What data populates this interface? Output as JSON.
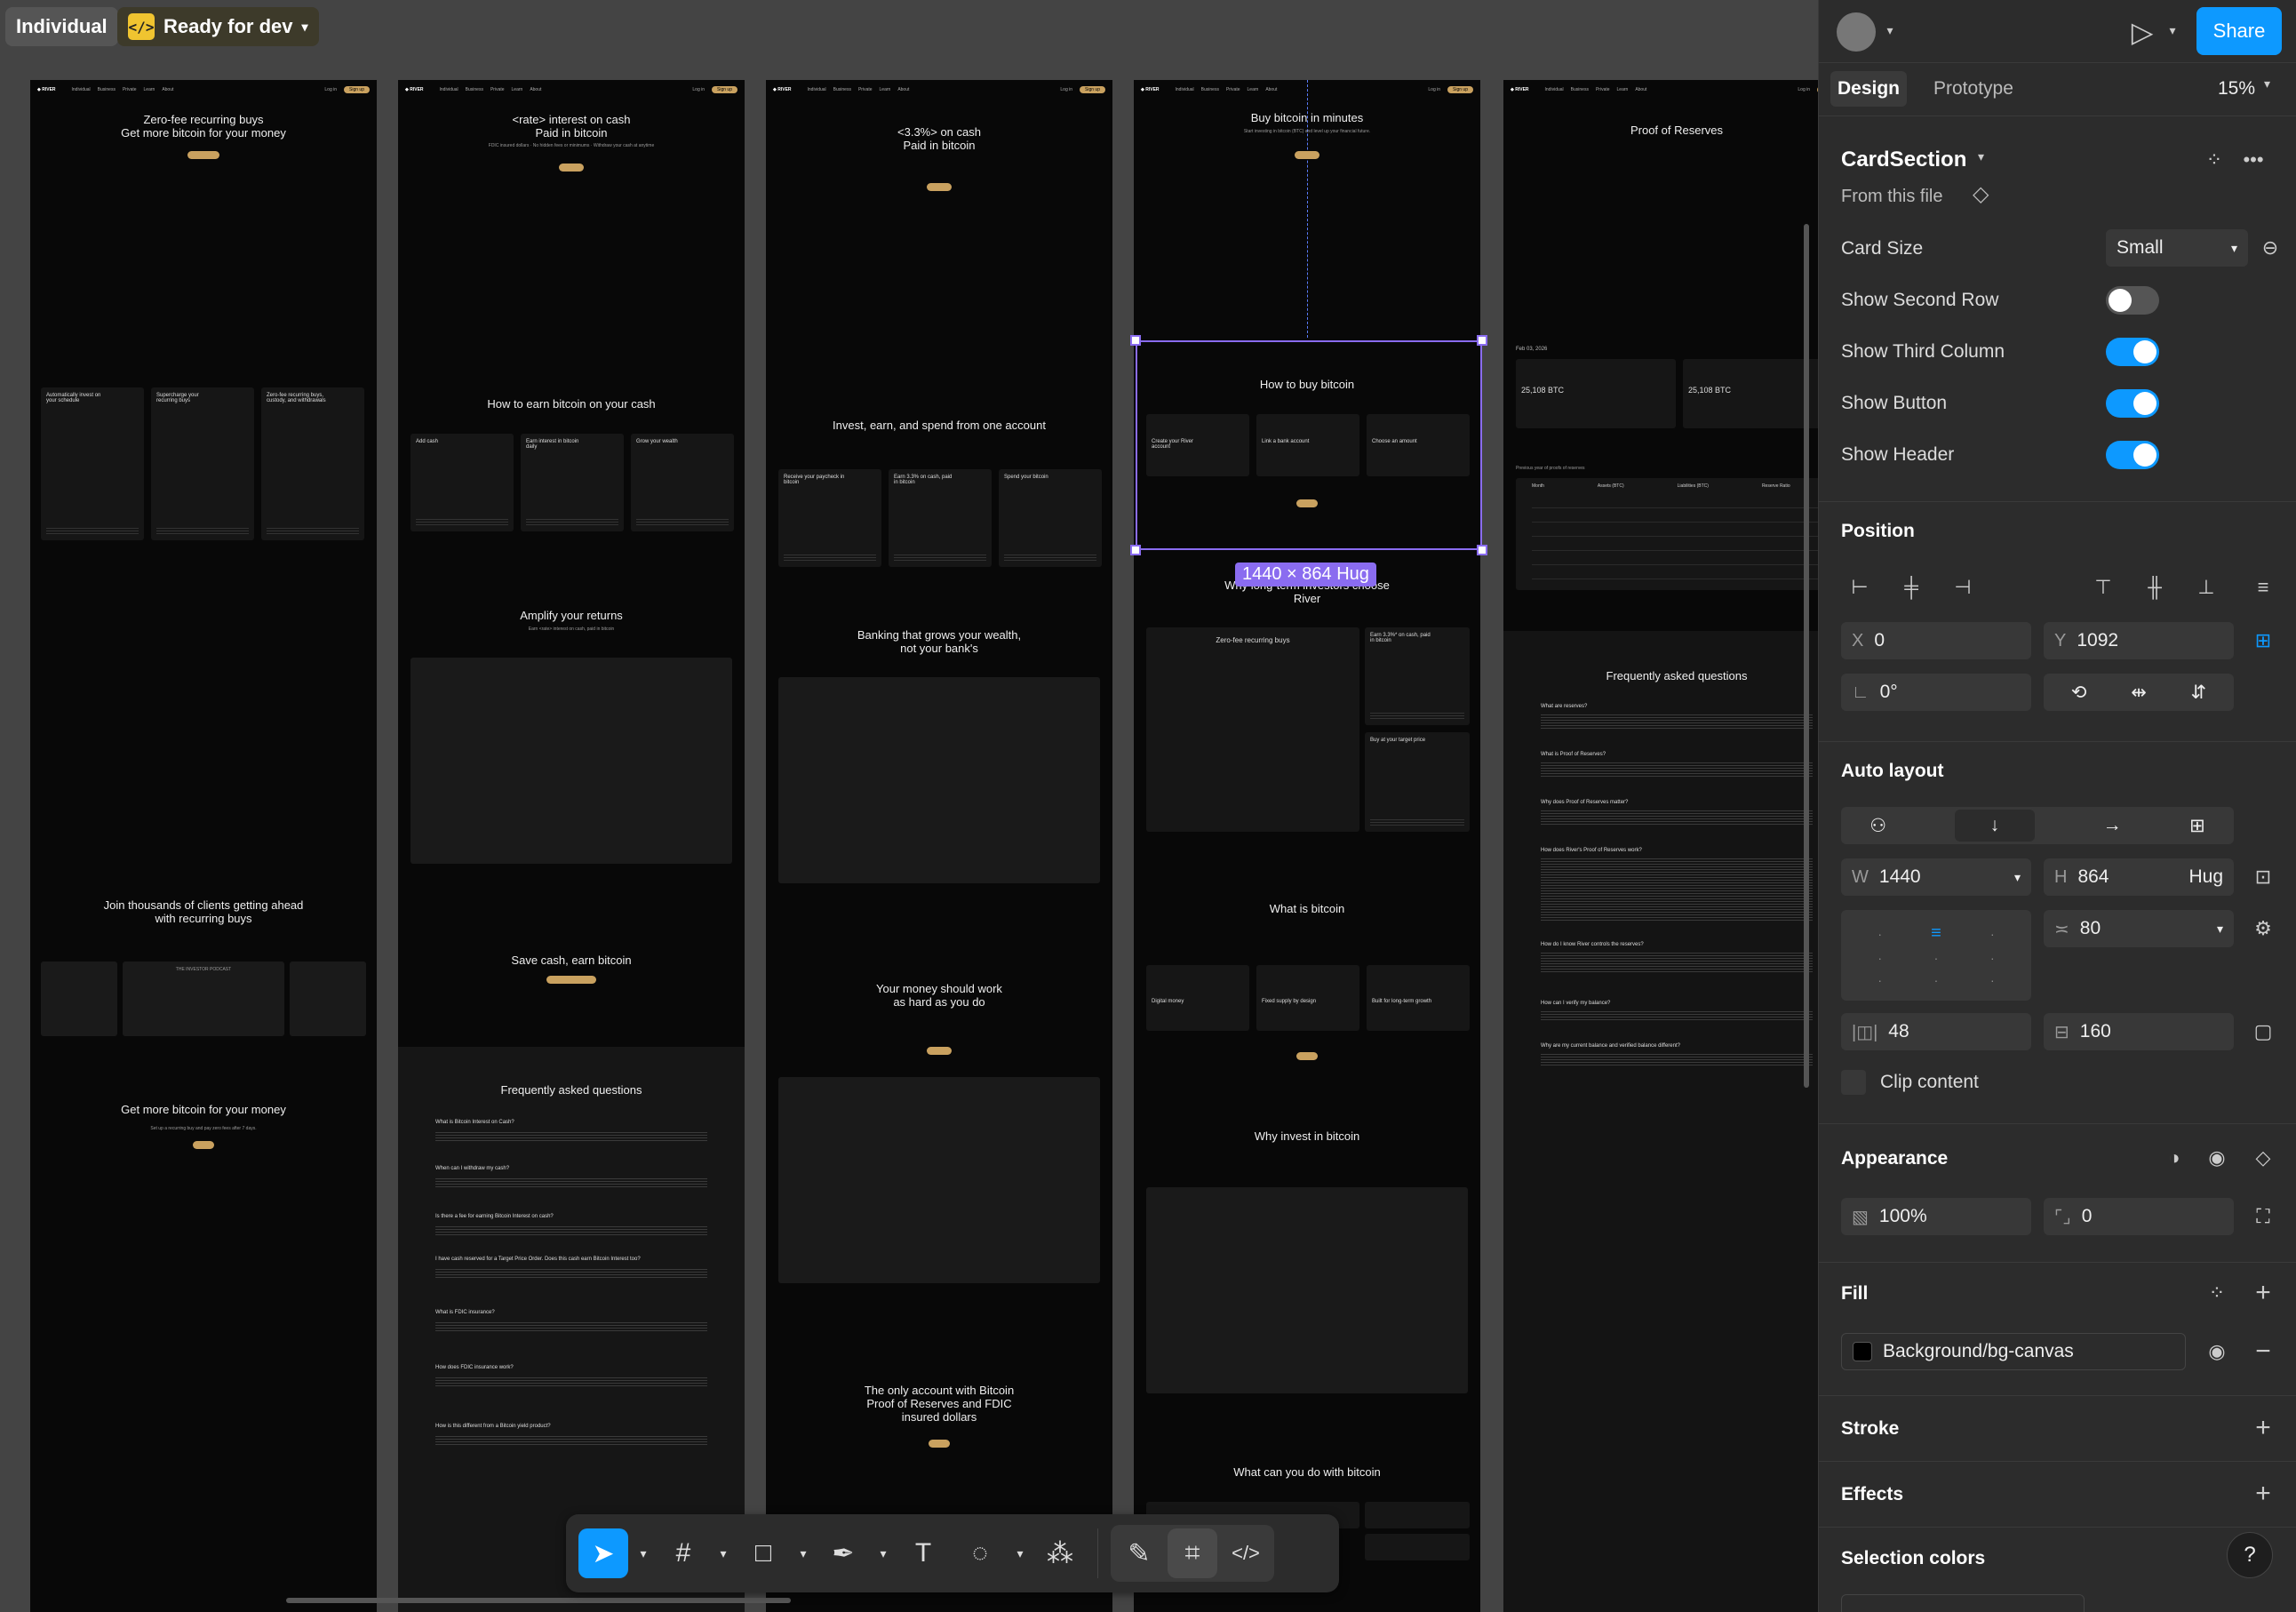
{
  "topbar": {
    "individual": "Individual",
    "ready_for_dev": "Ready for dev",
    "dev_icon": "</>"
  },
  "selection_badge": "1440 × 864 Hug",
  "frames": [
    {
      "hero_title": "Zero-fee recurring buys\nGet more bitcoin for your money",
      "card_titles": [
        "Automatically invest on your schedule",
        "Supercharge your recurring buys",
        "Zero-fee recurring buys, custody, and withdrawals"
      ],
      "section1": "Join thousands of clients getting ahead\nwith recurring buys",
      "podcast": "THE INVESTOR PODCAST",
      "section2": "Get more bitcoin for your money",
      "section2_sub": "Set up a recurring buy and pay zero fees after 7 days."
    },
    {
      "hero_title": "<rate> interest on cash\nPaid in bitcoin",
      "hero_sub": "FDIC insured dollars · No hidden fees or minimums · Withdraw your cash at anytime",
      "section1": "How to earn bitcoin on your cash",
      "card_titles": [
        "Add cash",
        "Earn interest in bitcoin daily",
        "Grow your wealth"
      ],
      "section2": "Amplify your returns",
      "section2_sub": "Earn <rate> interest on cash, paid in bitcoin",
      "section3": "Save cash, earn bitcoin",
      "faq_title": "Frequently asked questions",
      "faq_items": [
        "What is Bitcoin Interest on Cash?",
        "When can I withdraw my cash?",
        "Is there a fee for earning Bitcoin Interest on cash?",
        "I have cash reserved for a Target Price Order. Does this cash earn Bitcoin Interest too?",
        "What is FDIC insurance?",
        "How does FDIC insurance work?",
        "How is this different from a Bitcoin yield product?"
      ]
    },
    {
      "hero_title": "<3.3%> on cash\nPaid in bitcoin",
      "section1": "Invest, earn, and spend from one account",
      "card_titles": [
        "Receive your paycheck in bitcoin",
        "Earn 3.3% on cash, paid in bitcoin",
        "Spend your bitcoin"
      ],
      "section2": "Banking that grows your wealth,\nnot your bank's",
      "section3": "Your money should work\nas hard as you do",
      "section4": "The only account with Bitcoin\nProof of Reserves and FDIC\ninsured dollars"
    },
    {
      "hero_title": "Buy bitcoin in minutes",
      "hero_sub": "Start investing in bitcoin (BTC) and level up your financial future.",
      "selected_title": "How to buy bitcoin",
      "card_titles": [
        "Create your River account",
        "Link a bank account",
        "Choose an amount"
      ],
      "section1": "Why long-term investors choose\nRiver",
      "feature_cards": [
        "Zero-fee recurring buys",
        "Earn 3.3%* on cash, paid in bitcoin",
        "Buy at your target price"
      ],
      "section2": "What is bitcoin",
      "section2_cards": [
        "Digital money",
        "Fixed supply by design",
        "Built for long-term growth"
      ],
      "section3": "Why invest in bitcoin",
      "section4": "What can you do with bitcoin"
    },
    {
      "hero_title": "Proof of Reserves",
      "date": "Feb 03, 2026",
      "stats": [
        "25,108 BTC",
        "25,108 BTC"
      ],
      "table_label": "Previous year of proofs of reserves",
      "table_headers": [
        "Month",
        "Assets (BTC)",
        "Liabilities (BTC)",
        "Reserve Ratio"
      ],
      "faq_title": "Frequently asked questions",
      "faq_items": [
        "What are reserves?",
        "What is Proof of Reserves?",
        "Why does Proof of Reserves matter?",
        "How does River's Proof of Reserves work?",
        "How do I know River controls the reserves?",
        "How can I verify my balance?",
        "Why are my current balance and verified balance different?"
      ]
    }
  ],
  "toolbar": {
    "items": [
      "move-tool",
      "frame-tool",
      "shape-tool",
      "pen-tool",
      "text-tool",
      "comment-tool",
      "actions-tool",
      "draw-mode",
      "design-mode",
      "dev-mode"
    ]
  },
  "panel": {
    "tabs": {
      "design": "Design",
      "prototype": "Prototype",
      "zoom": "15%"
    },
    "share": "Share",
    "component": {
      "name": "CardSection",
      "source": "From this file"
    },
    "props": [
      {
        "label": "Card Size",
        "value": "Small"
      },
      {
        "label": "Show Second Row",
        "on": false
      },
      {
        "label": "Show Third Column",
        "on": true
      },
      {
        "label": "Show Button",
        "on": true
      },
      {
        "label": "Show Header",
        "on": true
      }
    ],
    "position": {
      "title": "Position",
      "x_label": "X",
      "x": "0",
      "y_label": "Y",
      "y": "1092",
      "rotation": "0°"
    },
    "autolayout": {
      "title": "Auto layout",
      "w_label": "W",
      "w": "1440",
      "h_label": "H",
      "h": "864",
      "h_mode": "Hug",
      "gap": "80",
      "padding_h": "48",
      "padding_v": "160",
      "clip": "Clip content"
    },
    "appearance": {
      "title": "Appearance",
      "opacity": "100%",
      "radius": "0"
    },
    "fill": {
      "title": "Fill",
      "swatch": "Background/bg-canvas",
      "color": "#000000"
    },
    "stroke": "Stroke",
    "effects": "Effects",
    "selection_colors": "Selection colors",
    "help": "?"
  }
}
